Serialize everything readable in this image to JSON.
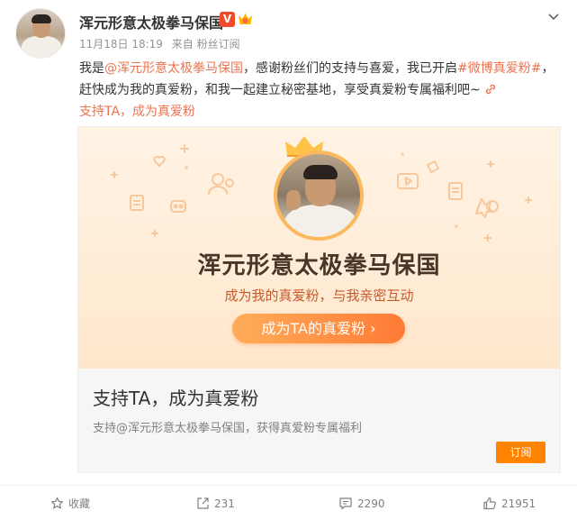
{
  "post": {
    "author_name": "浑元形意太极拳马保国",
    "verified_badge": "V",
    "time": "11月18日 18:19",
    "source": "来自 粉丝订阅",
    "text": {
      "p1": "我是",
      "mention": "@浑元形意太极拳马保国",
      "p2": "，感谢粉丝们的支持与喜爱，我已开启",
      "hashtag": "#微博真爱粉#",
      "p3": "，赶快成为我的真爱粉，和我一起建立秘密基地，享受真爱粉专属福利吧~",
      "link": "支持TA，成为真爱粉"
    }
  },
  "card": {
    "banner_title": "浑元形意太极拳马保国",
    "banner_subtitle": "成为我的真爱粉，与我亲密互动",
    "banner_button": "成为TA的真爱粉 ›",
    "title": "支持TA，成为真爱粉",
    "description": "支持@浑元形意太极拳马保国，获得真爱粉专属福利",
    "subscribe_button": "订阅"
  },
  "footer": {
    "favorite": "收藏",
    "repost": "231",
    "comment": "2290",
    "like": "21951"
  },
  "colors": {
    "accent": "#eb7350",
    "subscribe": "#ff8200",
    "verified": "#f04b2b"
  },
  "icons": [
    "chevron-down-icon",
    "link-icon",
    "star-icon",
    "repost-icon",
    "comment-icon",
    "like-icon",
    "crown-icon"
  ]
}
